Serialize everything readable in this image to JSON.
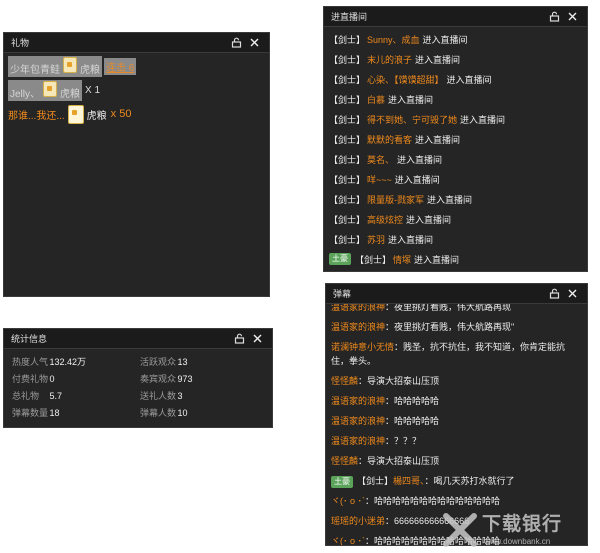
{
  "gift_panel": {
    "title": "礼物",
    "rows": [
      {
        "user": "少年包青鲑",
        "gift": "虎粮",
        "suffix": "连击 6"
      },
      {
        "user": "Jelly、",
        "gift": "虎粮",
        "suffix": "X 1"
      },
      {
        "user": "那谁...我还...",
        "gift": "虎粮",
        "suffix": "x 50"
      }
    ]
  },
  "stats_panel": {
    "title": "统计信息",
    "left": [
      {
        "label": "热度人气",
        "value": "132.42万"
      },
      {
        "label": "付费礼物",
        "value": "0"
      },
      {
        "label": "总礼物",
        "value": "5.7"
      },
      {
        "label": "弹幕数量",
        "value": "18"
      }
    ],
    "right": [
      {
        "label": "活跃观众",
        "value": "13"
      },
      {
        "label": "奏宾观众",
        "value": "973"
      },
      {
        "label": "送礼人数",
        "value": "3"
      },
      {
        "label": "弹幕人数",
        "value": "10"
      }
    ]
  },
  "entry_panel": {
    "title": "进直播间",
    "rank": "【剑士】",
    "action": "进入直播间",
    "master_badge": "土豪",
    "users": [
      "Sunny、成血",
      "末儿的浪子",
      "心染、【馍馍超甜】",
      "白慕",
      "得不到她、宁可毁了她",
      "默默的看客",
      "莫名、",
      "咩~~~",
      "限量版-戮家军",
      "高级炫控",
      "苏羽",
      "情塚"
    ]
  },
  "barrage_panel": {
    "title": "弹幕",
    "master_badge": "土豪",
    "rank": "【剑士】",
    "messages": [
      {
        "user": "温语家的浪神",
        "text": "夜里挑灯看贱，伟大航路再现"
      },
      {
        "user": "温语家的浪神",
        "text": "夜里挑灯看贱，伟大航路再现\""
      },
      {
        "user": "诺澜钟意小无情",
        "text": "贱圣，抗不抗住，我不知道，你肯定能抗住，拳头。"
      },
      {
        "user": "怪怪麟",
        "text": "导演大招泰山压顶"
      },
      {
        "user": "温语家的浪神",
        "text": "哈哈哈哈哈"
      },
      {
        "user": "温语家的浪神",
        "text": "哈哈哈哈哈"
      },
      {
        "user": "温语家的浪神",
        "text": "？？？"
      },
      {
        "user": "怪怪麟",
        "text": "导演大招泰山压顶"
      },
      {
        "user": "楊四哥、",
        "text": "喝几天苏打水就行了"
      },
      {
        "user": "ヾ(･ o ･`",
        "text": "哈哈哈哈哈哈哈哈哈哈哈哈哈哈"
      },
      {
        "user": "瑶瑶的小迷弟",
        "text": "666666666666666"
      },
      {
        "user": "ヾ(･ o ･`",
        "text": "哈哈哈哈哈哈哈哈哈哈哈哈哈哈"
      }
    ]
  },
  "watermark": {
    "text": "下载银行",
    "url": "www.downbank.cn"
  }
}
